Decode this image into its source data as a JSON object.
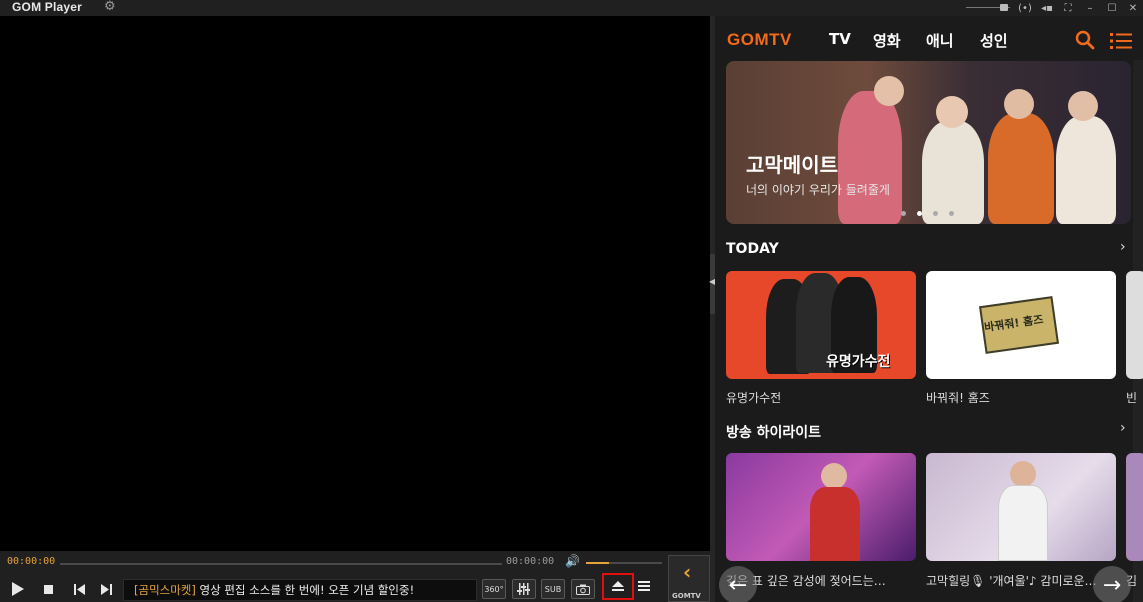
{
  "titlebar": {
    "app_title": "GOM Player",
    "controls": [
      "—",
      "(•)",
      "◂▪",
      "⛶",
      "–",
      "☐",
      "✕"
    ]
  },
  "player": {
    "time_current": "00:00:00",
    "time_total": "00:00:00",
    "volume_level": 0.3,
    "ticker_tag": "[곰믹스마켓]",
    "ticker_text": " 영상 편집 소스를 한 번에! 오픈 기념 할인중!",
    "btn_360": "360°",
    "btn_sub": "SUB",
    "gomtv_label": "GOMTV"
  },
  "panel": {
    "logo": "GOMTV",
    "nav": [
      "TV",
      "영화",
      "애니",
      "성인"
    ],
    "banner": {
      "title": "고막메이트",
      "subtitle": "너의 이야기 우리가 들려줄게"
    },
    "sections": [
      {
        "title": "TODAY",
        "cards": [
          {
            "label": "유명가수전",
            "art_text": "유명가수전"
          },
          {
            "label": "바꿔줘! 홈즈",
            "art_text": "바꿔줘! 홈즈"
          },
          {
            "label": "빈"
          }
        ]
      },
      {
        "title": "방송 하이라이트",
        "cards": [
          {
            "label": "깊은 표 깊은 감성에 젖어드는…"
          },
          {
            "label": "고막힐링🎙 '개여울'♪ 감미로운…"
          },
          {
            "label": "김"
          }
        ]
      }
    ]
  },
  "colors": {
    "accent": "#e3a33a",
    "gomtv_orange": "#f26a1b",
    "highlight_red": "#e01010"
  }
}
